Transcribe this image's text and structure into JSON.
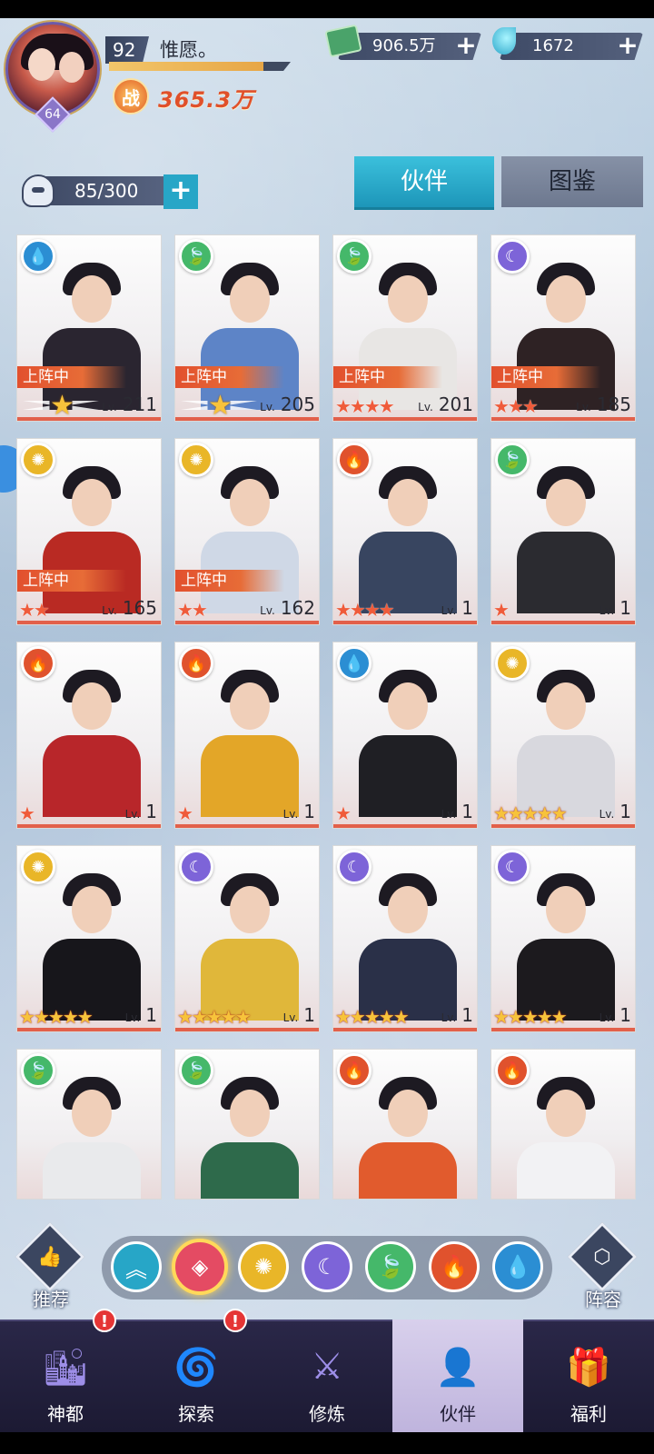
{
  "player": {
    "level": "92",
    "name": "惟愿。",
    "avatar_level": "64",
    "power_icon": "战",
    "power": "365.3万",
    "exp_fraction": 0.85
  },
  "currency": {
    "gold": "906.5万",
    "gems": "1672"
  },
  "roster": {
    "capacity": "85/300"
  },
  "tabs": [
    "伙伴",
    "图鉴"
  ],
  "labels": {
    "deployed": "上阵中",
    "lv": "Lv."
  },
  "partners": [
    {
      "element": "water-icon",
      "deployed": true,
      "stars": 5,
      "star_style": "wing",
      "level": "211",
      "art": "#2a2530"
    },
    {
      "element": "wind-icon",
      "deployed": true,
      "stars": 5,
      "star_style": "wing",
      "level": "205",
      "art": "#5d84c7"
    },
    {
      "element": "wind-icon",
      "deployed": true,
      "stars": 4,
      "star_style": "red",
      "level": "201",
      "art": "#e8e6e4"
    },
    {
      "element": "moon-icon",
      "deployed": true,
      "stars": 3,
      "star_style": "red",
      "level": "185",
      "art": "#2e2224"
    },
    {
      "element": "sun-icon",
      "deployed": true,
      "stars": 2,
      "star_style": "red",
      "level": "165",
      "art": "#b92a23"
    },
    {
      "element": "sun-icon",
      "deployed": true,
      "stars": 2,
      "star_style": "red",
      "level": "162",
      "art": "#cfd8e6"
    },
    {
      "element": "fire-icon",
      "deployed": false,
      "stars": 4,
      "star_style": "red",
      "level": "1",
      "art": "#384560"
    },
    {
      "element": "wind-icon",
      "deployed": false,
      "stars": 1,
      "star_style": "red",
      "level": "1",
      "art": "#2b2b30"
    },
    {
      "element": "fire-icon",
      "deployed": false,
      "stars": 1,
      "star_style": "red",
      "level": "1",
      "art": "#b8262a"
    },
    {
      "element": "fire-icon",
      "deployed": false,
      "stars": 1,
      "star_style": "red",
      "level": "1",
      "art": "#e3a628"
    },
    {
      "element": "water-icon",
      "deployed": false,
      "stars": 1,
      "star_style": "red",
      "level": "1",
      "art": "#1f1f24"
    },
    {
      "element": "sun-icon",
      "deployed": false,
      "stars": 5,
      "star_style": "gold",
      "level": "1",
      "art": "#d8d8de"
    },
    {
      "element": "sun-icon",
      "deployed": false,
      "stars": 5,
      "star_style": "gold",
      "level": "1",
      "art": "#17161b"
    },
    {
      "element": "moon-icon",
      "deployed": false,
      "stars": 5,
      "star_style": "gold",
      "level": "1",
      "art": "#e0b73a"
    },
    {
      "element": "moon-icon",
      "deployed": false,
      "stars": 5,
      "star_style": "gold",
      "level": "1",
      "art": "#2a3048"
    },
    {
      "element": "moon-icon",
      "deployed": false,
      "stars": 5,
      "star_style": "gold",
      "level": "1",
      "art": "#1c1a1e"
    },
    {
      "element": "wind-icon",
      "deployed": false,
      "stars": 0,
      "star_style": "none",
      "level": "",
      "art": "#e9eaec"
    },
    {
      "element": "wind-icon",
      "deployed": false,
      "stars": 0,
      "star_style": "none",
      "level": "",
      "art": "#2e6a4b"
    },
    {
      "element": "fire-icon",
      "deployed": false,
      "stars": 0,
      "star_style": "none",
      "level": "",
      "art": "#e15b2d"
    },
    {
      "element": "fire-icon",
      "deployed": false,
      "stars": 0,
      "star_style": "none",
      "level": "",
      "art": "#f2f2f4"
    }
  ],
  "filters": [
    {
      "icon": "chevron-up-icon",
      "color": "#27a6c7",
      "selected": false
    },
    {
      "icon": "gem-diamond-icon",
      "color": "#e44b63",
      "selected": true
    },
    {
      "icon": "sun-icon",
      "color": "#e9b628",
      "selected": false
    },
    {
      "icon": "moon-icon",
      "color": "#7d64d8",
      "selected": false
    },
    {
      "icon": "wind-icon",
      "color": "#45b86a",
      "selected": false
    },
    {
      "icon": "fire-icon",
      "color": "#e0522d",
      "selected": false
    },
    {
      "icon": "water-icon",
      "color": "#2b8ed3",
      "selected": false
    }
  ],
  "side_buttons": {
    "recommend": "推荐",
    "formation": "阵容"
  },
  "nav": [
    {
      "label": "神都",
      "icon": "city-icon",
      "badge": "!",
      "active": false
    },
    {
      "label": "探索",
      "icon": "portal-icon",
      "badge": "!",
      "active": false
    },
    {
      "label": "修炼",
      "icon": "sword-icon",
      "badge": "",
      "active": false
    },
    {
      "label": "伙伴",
      "icon": "hooded-figure-icon",
      "badge": "",
      "active": true
    },
    {
      "label": "福利",
      "icon": "gift-chest-icon",
      "badge": "",
      "active": false
    }
  ]
}
